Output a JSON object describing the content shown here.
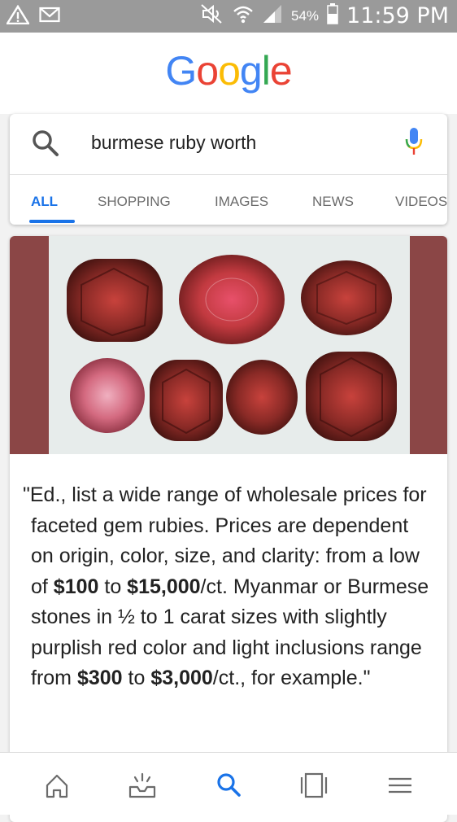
{
  "statusbar": {
    "battery": "54%",
    "time": "11:59 PM",
    "icons": [
      "warning-icon",
      "mail-icon",
      "mute-icon",
      "wifi-icon",
      "signal-icon",
      "battery-icon"
    ]
  },
  "logo": {
    "letters": [
      "G",
      "o",
      "o",
      "g",
      "l",
      "e"
    ]
  },
  "search": {
    "query": "burmese ruby worth"
  },
  "tabs": [
    {
      "label": "ALL",
      "active": true
    },
    {
      "label": "SHOPPING",
      "active": false
    },
    {
      "label": "IMAGES",
      "active": false
    },
    {
      "label": "NEWS",
      "active": false
    },
    {
      "label": "VIDEOS",
      "active": false
    }
  ],
  "snippet": {
    "t1": "\"Ed., list a wide range of wholesale prices for faceted gem rubies. Prices are dependent on origin, color, size, and clarity: from a low of ",
    "b1": "$100",
    "t2": " to ",
    "b2": "$15,000",
    "t3": "/ct. Myanmar or Burmese stones in ½ to 1 carat sizes with slightly purplish red color and light inclusions range from ",
    "b3": "$300",
    "t4": " to ",
    "b4": "$3,000",
    "t5": "/ct., for example.\""
  },
  "bottomnav": [
    "home-icon",
    "updates-icon",
    "search-icon",
    "tabs-icon",
    "menu-icon"
  ],
  "colors": {
    "accent": "#1a73e8",
    "status_bar": "#9a9a9a",
    "image_border": "#8b4646"
  }
}
